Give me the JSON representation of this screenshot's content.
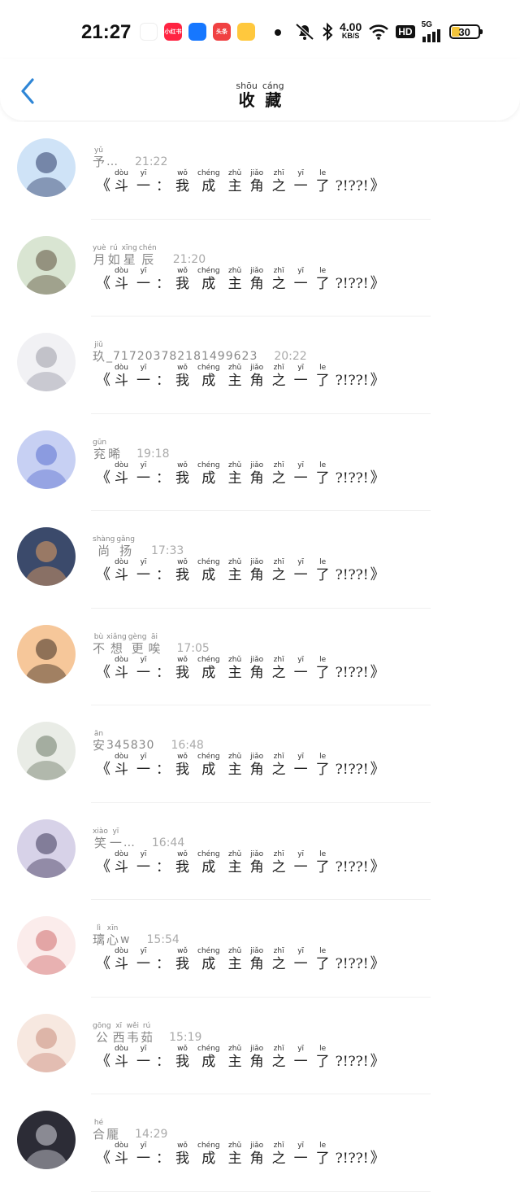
{
  "status_bar": {
    "time": "21:27",
    "apps": [
      {
        "icon": "taobao-icon",
        "label": "",
        "color": "#ffffff"
      },
      {
        "icon": "xiaohongshu-icon",
        "label": "小红书",
        "color": "#ff2442"
      },
      {
        "icon": "alipay-icon",
        "label": "",
        "color": "#1677ff"
      },
      {
        "icon": "toutiao-icon",
        "label": "头条",
        "color": "#f04142"
      },
      {
        "icon": "gift-icon",
        "label": "",
        "color": "#ffc83d"
      }
    ],
    "net_speed": "4.00",
    "net_unit": "KB/S",
    "hd": "HD",
    "signal": "5G",
    "battery": "30"
  },
  "header": {
    "title": [
      {
        "py": "shōu",
        "hz": "收"
      },
      {
        "py": "cáng",
        "hz": "藏"
      }
    ]
  },
  "message": {
    "open": "《",
    "chars": [
      {
        "py": "dòu",
        "hz": "斗"
      },
      {
        "py": "yī",
        "hz": "一"
      },
      {
        "punct": "："
      },
      {
        "py": "wǒ",
        "hz": "我"
      },
      {
        "py": "chéng",
        "hz": "成"
      },
      {
        "py": "zhǔ",
        "hz": "主"
      },
      {
        "py": "jiǎo",
        "hz": "角"
      },
      {
        "py": "zhī",
        "hz": "之"
      },
      {
        "py": "yī",
        "hz": "一"
      },
      {
        "py": "le",
        "hz": "了"
      },
      {
        "punct": "?!??!"
      }
    ],
    "close": "》"
  },
  "items": [
    {
      "name": [
        {
          "py": "yǔ",
          "hz": "予"
        }
      ],
      "suffix": "…",
      "time": "21:22",
      "avatar": {
        "bg": "#cfe3f7",
        "fg": "#2b3a67"
      }
    },
    {
      "name": [
        {
          "py": "yuè",
          "hz": "月"
        },
        {
          "py": "rú",
          "hz": "如"
        },
        {
          "py": "xīng",
          "hz": "星"
        },
        {
          "py": "chén",
          "hz": "辰"
        }
      ],
      "suffix": "",
      "time": "21:20",
      "avatar": {
        "bg": "#d9e5d2",
        "fg": "#5b4f3a"
      }
    },
    {
      "name": [
        {
          "py": "jiǔ",
          "hz": "玖"
        }
      ],
      "suffix": "_717203782181499623",
      "time": "20:22",
      "avatar": {
        "bg": "#f1f1f4",
        "fg": "#9a9aa6"
      }
    },
    {
      "name": [
        {
          "py": "gūn",
          "hz": "兖"
        },
        {
          "py": "",
          "hz": "晞"
        }
      ],
      "suffix": "",
      "time": "19:18",
      "avatar": {
        "bg": "#c7d0f3",
        "fg": "#5a6fd0"
      }
    },
    {
      "name": [
        {
          "py": "shàng",
          "hz": "尚"
        },
        {
          "py": "gǎng",
          "hz": "扬"
        }
      ],
      "suffix": "",
      "time": "17:33",
      "avatar": {
        "bg": "#3b4a6b",
        "fg": "#e8a060"
      }
    },
    {
      "name": [
        {
          "py": "bù",
          "hz": "不"
        },
        {
          "py": "xiǎng",
          "hz": "想"
        },
        {
          "py": "gèng",
          "hz": "更"
        },
        {
          "py": "āi",
          "hz": "唉"
        }
      ],
      "suffix": "",
      "time": "17:05",
      "avatar": {
        "bg": "#f6c79a",
        "fg": "#3a2a20"
      }
    },
    {
      "name": [
        {
          "py": "ān",
          "hz": "安"
        }
      ],
      "suffix": "345830",
      "time": "16:48",
      "avatar": {
        "bg": "#e9ece6",
        "fg": "#6c7a66"
      }
    },
    {
      "name": [
        {
          "py": "xiào",
          "hz": "笑"
        },
        {
          "py": "yī",
          "hz": "一"
        }
      ],
      "suffix": "…",
      "time": "16:44",
      "avatar": {
        "bg": "#d7d2e8",
        "fg": "#3d3658"
      }
    },
    {
      "name": [
        {
          "py": "lì",
          "hz": "璃"
        },
        {
          "py": "xīn",
          "hz": "心"
        }
      ],
      "suffix": "w",
      "time": "15:54",
      "avatar": {
        "bg": "#fbeceb",
        "fg": "#d06b6b"
      }
    },
    {
      "name": [
        {
          "py": "gōng",
          "hz": "公"
        },
        {
          "py": "xī",
          "hz": "西"
        },
        {
          "py": "wěi",
          "hz": "韦"
        },
        {
          "py": "rú",
          "hz": "茹"
        }
      ],
      "suffix": "",
      "time": "15:19",
      "avatar": {
        "bg": "#f7e8e0",
        "fg": "#c98a7a"
      }
    },
    {
      "name": [
        {
          "py": "hé",
          "hz": "合"
        },
        {
          "py": "",
          "hz": "龎"
        }
      ],
      "suffix": "",
      "time": "14:29",
      "avatar": {
        "bg": "#2c2c36",
        "fg": "#d8d8e0"
      }
    }
  ]
}
